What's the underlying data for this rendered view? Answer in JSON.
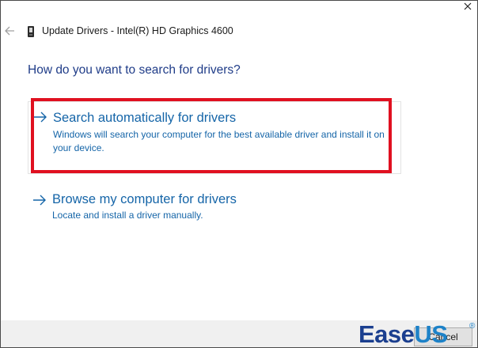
{
  "window": {
    "title": "Update Drivers - Intel(R) HD Graphics 4600",
    "close_icon": "close-icon",
    "back_icon": "back-arrow-icon",
    "device_icon": "device-icon"
  },
  "main": {
    "heading": "How do you want to search for drivers?",
    "options": [
      {
        "title": "Search automatically for drivers",
        "description": "Windows will search your computer for the best available driver and install it on your device.",
        "icon": "arrow-right-icon",
        "highlighted": true
      },
      {
        "title": "Browse my computer for drivers",
        "description": "Locate and install a driver manually.",
        "icon": "arrow-right-icon",
        "highlighted": false
      }
    ]
  },
  "footer": {
    "cancel_label": "Cancel"
  },
  "watermark": {
    "part1": "Ease",
    "part2": "US",
    "registered": "®"
  },
  "colors": {
    "link_blue": "#1565a8",
    "heading_blue": "#1f3c88",
    "highlight_red": "#e01020",
    "footer_bg": "#f0f0f0"
  }
}
